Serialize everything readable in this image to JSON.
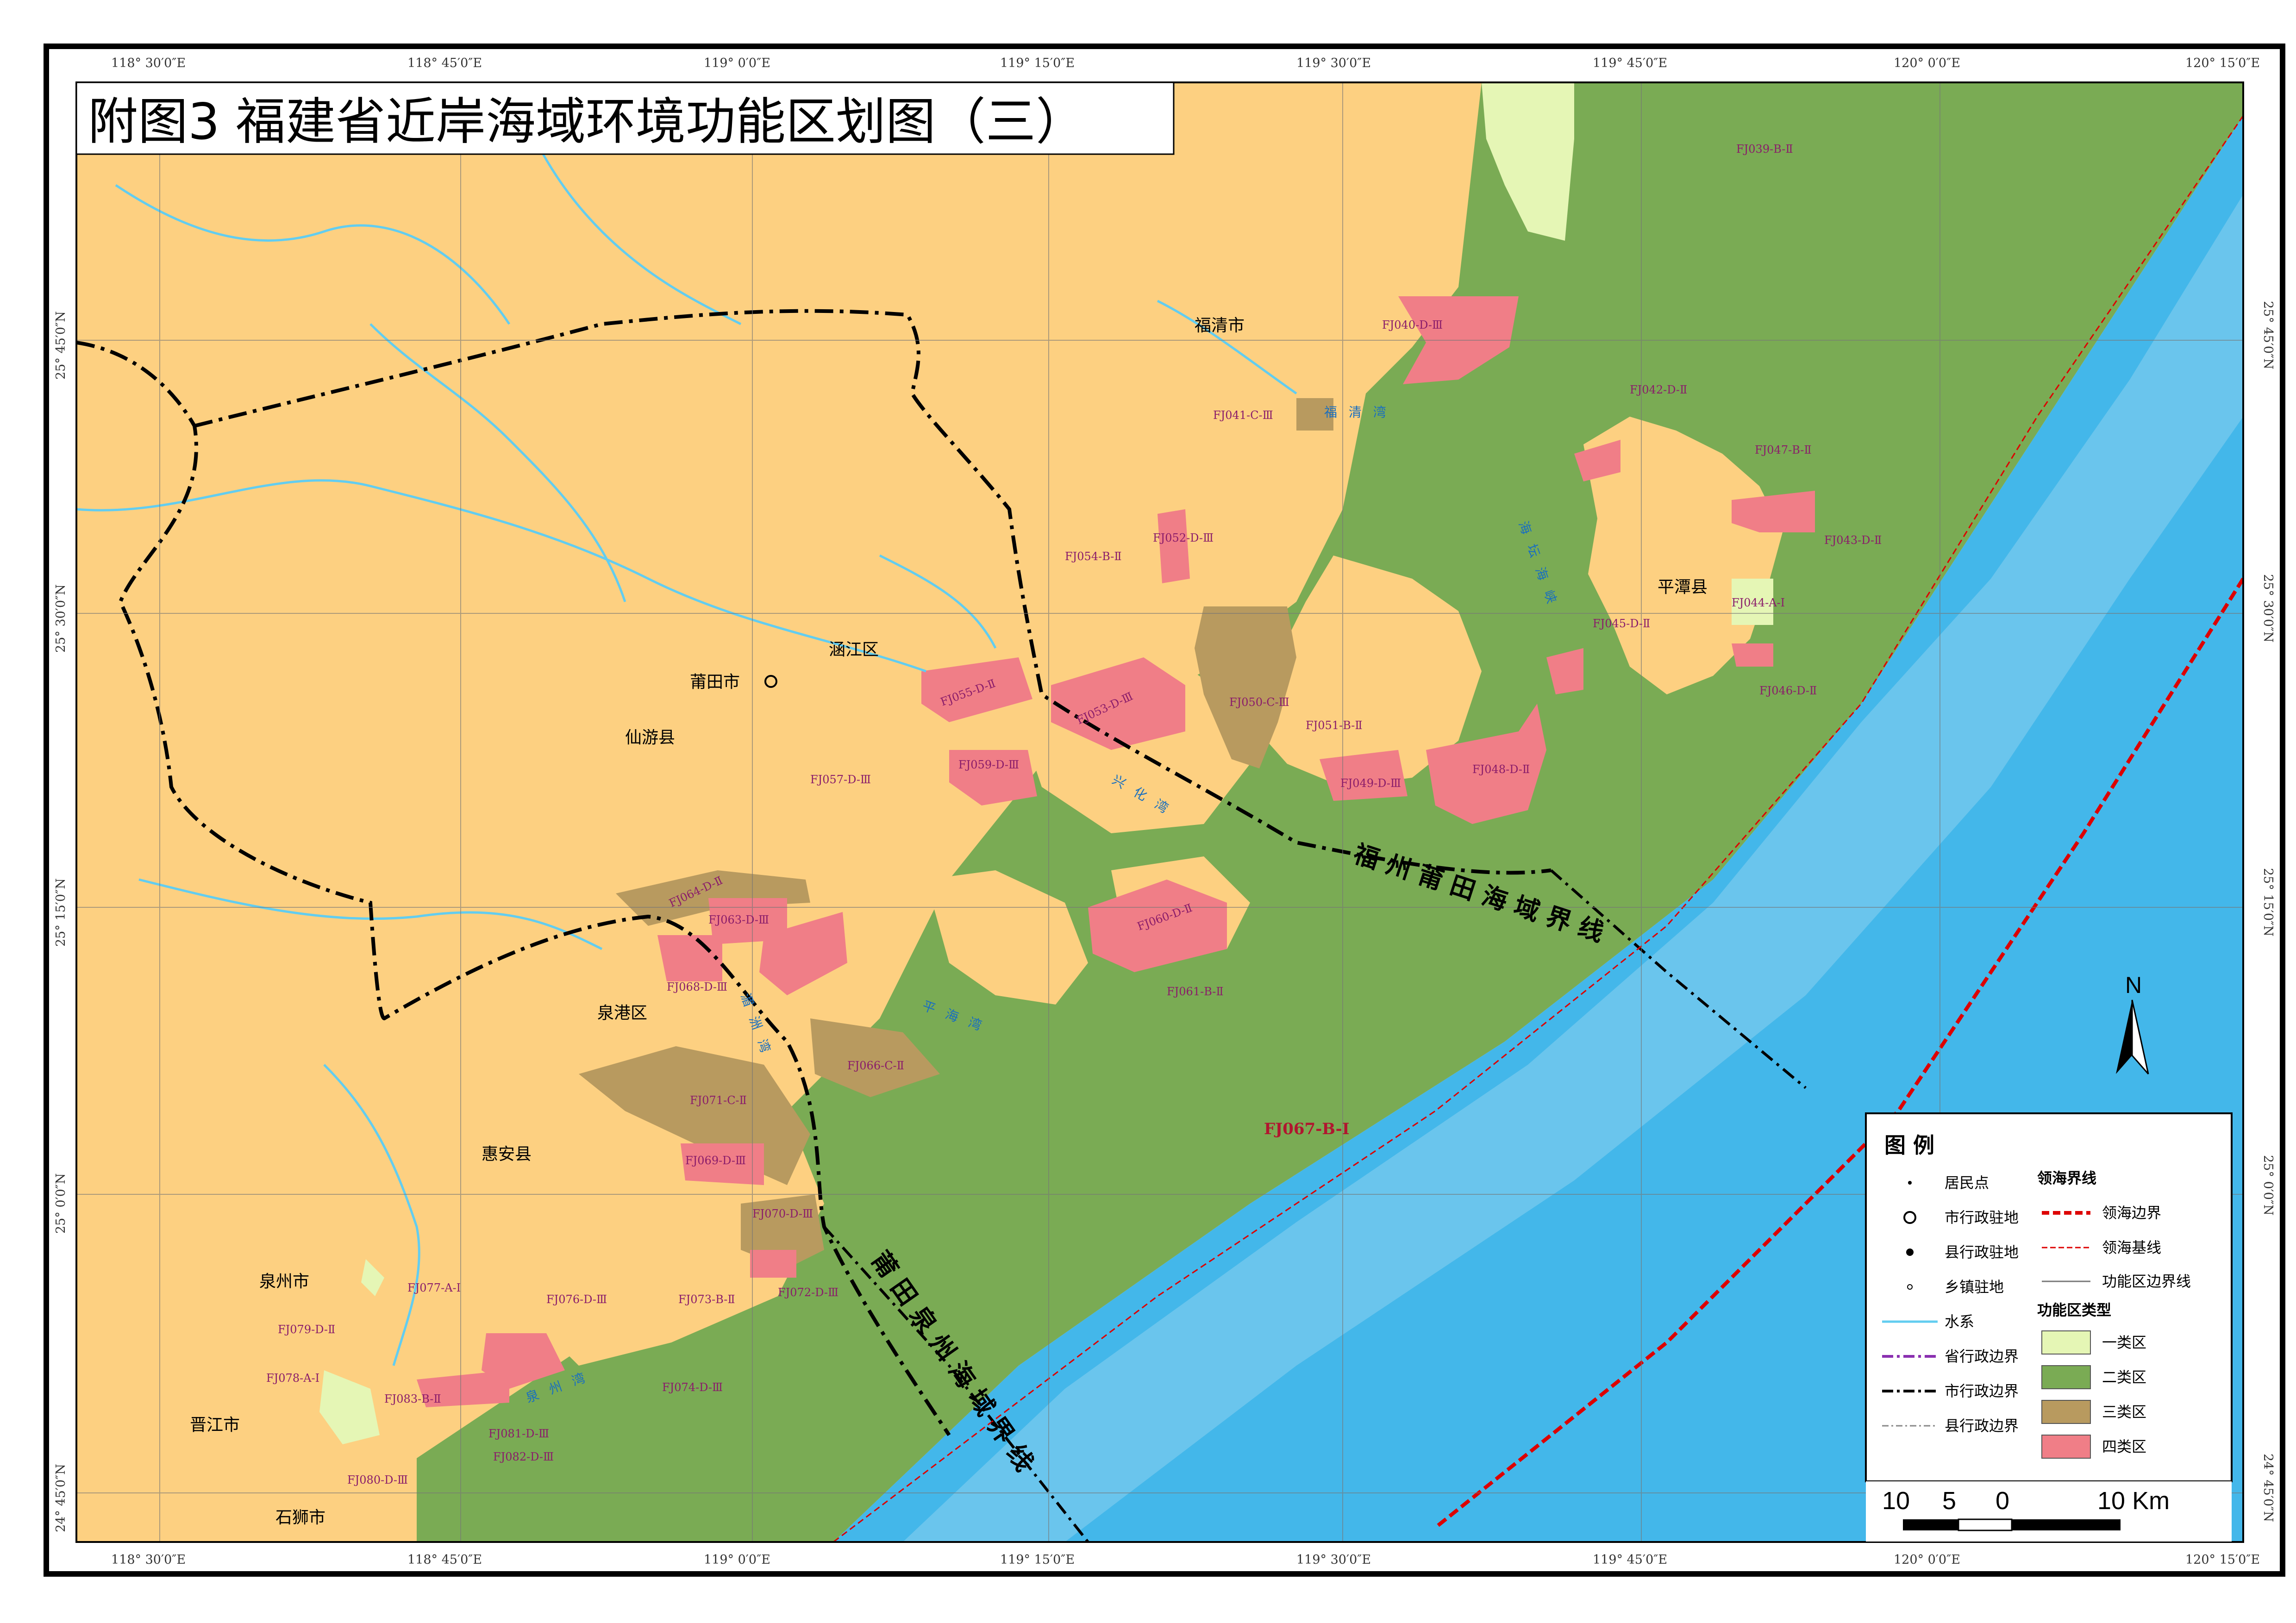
{
  "title": "附图3  福建省近岸海域环境功能区划图（三）",
  "coords_top": [
    "118° 30′0″E",
    "118° 45′0″E",
    "119° 0′0″E",
    "119° 15′0″E",
    "119° 30′0″E",
    "119° 45′0″E",
    "120° 0′0″E",
    "120° 15′0″E"
  ],
  "coords_left": [
    "25° 45′0″N",
    "25° 30′0″N",
    "25° 15′0″N",
    "25° 0′0″N",
    "24° 45′0″N"
  ],
  "cities": {
    "putian": "莆田市",
    "quanzhou": "泉州市",
    "fuqing": "福清市",
    "pingtan": "平潭县",
    "hanjiang": "涵江区",
    "xianyou": "仙游县",
    "quangang": "泉港区",
    "huian": "惠安县",
    "jinjiang": "晋江市",
    "shishi": "石狮市"
  },
  "bays": {
    "xinghua": "兴 化 湾",
    "pinghai": "平 海 湾",
    "meizhou": "湄 洲 湾",
    "fuqing_bay": "福 清 湾",
    "haitan": "海 坛 海 峡",
    "quanzhou_bay": "泉 州 湾"
  },
  "boundaries": {
    "fuzhou_putian": "福 州 莆 田 海 域 界 线",
    "putian_quanzhou": "莆 田 泉 州 海 域 界 线"
  },
  "zones": {
    "fj039": "FJ039-B-Ⅱ",
    "fj040": "FJ040-D-Ⅲ",
    "fj041": "FJ041-C-Ⅲ",
    "fj042": "FJ042-D-Ⅱ",
    "fj043": "FJ043-D-Ⅱ",
    "fj044": "FJ044-A-Ⅰ",
    "fj045": "FJ045-D-Ⅱ",
    "fj046": "FJ046-D-Ⅱ",
    "fj047": "FJ047-B-Ⅱ",
    "fj048": "FJ048-D-Ⅱ",
    "fj049": "FJ049-D-Ⅲ",
    "fj050": "FJ050-C-Ⅲ",
    "fj051": "FJ051-B-Ⅱ",
    "fj052": "FJ052-D-Ⅲ",
    "fj053": "FJ053-D-Ⅲ",
    "fj054": "FJ054-B-Ⅱ",
    "fj055": "FJ055-D-Ⅱ",
    "fj057": "FJ057-D-Ⅲ",
    "fj059": "FJ059-D-Ⅲ",
    "fj060": "FJ060-D-Ⅱ",
    "fj061": "FJ061-B-Ⅱ",
    "fj063": "FJ063-D-Ⅲ",
    "fj064": "FJ064-D-Ⅱ",
    "fj066": "FJ066-C-Ⅱ",
    "fj067": "FJ067-B-Ⅰ",
    "fj068": "FJ068-D-Ⅲ",
    "fj069": "FJ069-D-Ⅲ",
    "fj070": "FJ070-D-Ⅲ",
    "fj071": "FJ071-C-Ⅱ",
    "fj072": "FJ072-D-Ⅲ",
    "fj073": "FJ073-B-Ⅱ",
    "fj074": "FJ074-D-Ⅲ",
    "fj076": "FJ076-D-Ⅲ",
    "fj077": "FJ077-A-Ⅰ",
    "fj078": "FJ078-A-Ⅰ",
    "fj079": "FJ079-D-Ⅱ",
    "fj080": "FJ080-D-Ⅲ",
    "fj081": "FJ081-D-Ⅲ",
    "fj082": "FJ082-D-Ⅲ",
    "fj083": "FJ083-B-Ⅱ"
  },
  "legend": {
    "title": "图  例",
    "residence": "居民点",
    "city_seat": "市行政驻地",
    "county_seat": "县行政驻地",
    "town_seat": "乡镇驻地",
    "water": "水系",
    "prov_border": "省行政边界",
    "city_border": "市行政边界",
    "county_border": "县行政边界",
    "sea_title": "领海界线",
    "sea_border": "领海边界",
    "sea_base": "领海基线",
    "zone_line": "功能区边界线",
    "zone_type_title": "功能区类型",
    "class1": "一类区",
    "class2": "二类区",
    "class3": "三类区",
    "class4": "四类区"
  },
  "scale": {
    "labels": [
      "10",
      "5",
      "0",
      "10 Km"
    ]
  },
  "north": "N",
  "colors": {
    "land": "#fdd081",
    "class1": "#e5f6b5",
    "class2": "#7aab54",
    "class3": "#b89a5f",
    "class4": "#f07e87",
    "sea": "#43b7ea",
    "sea_light": "#74c8ee",
    "river": "#62cdf0"
  }
}
